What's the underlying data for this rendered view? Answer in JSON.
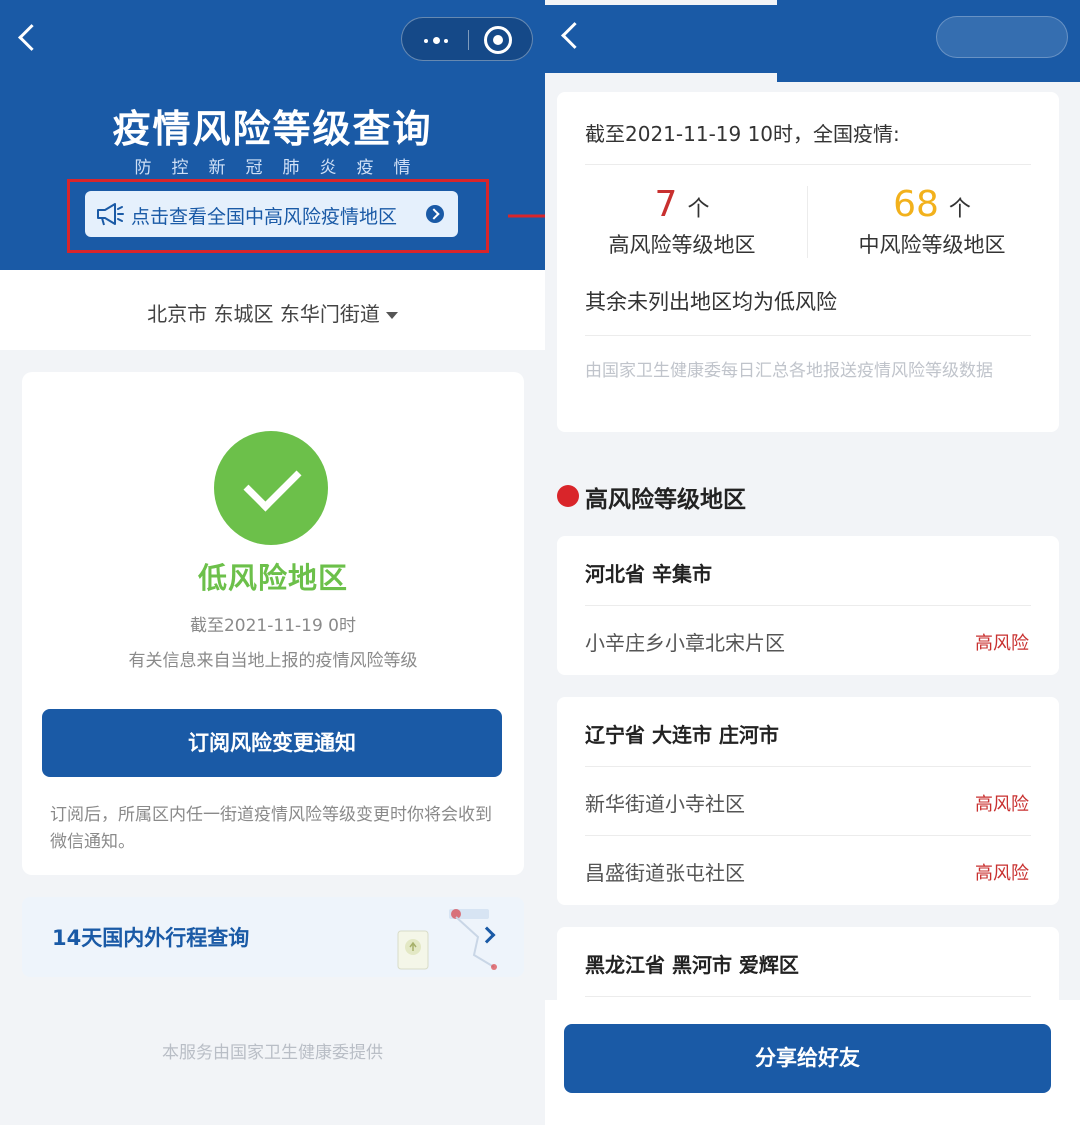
{
  "left": {
    "title": "疫情风险等级查询",
    "subtitle": "防控新冠肺炎疫情",
    "national_link": "点击查看全国中高风险疫情地区",
    "location": "北京市 东城区 东华门街道",
    "status": {
      "level": "低风险地区",
      "as_of": "截至2021-11-19 0时",
      "source": "有关信息来自当地上报的疫情风险等级"
    },
    "subscribe_button": "订阅风险变更通知",
    "subscribe_note": "订阅后，所属区内任一街道疫情风险等级变更时你将会收到微信通知。",
    "travel_query": "14天国内外行程查询",
    "footer": "本服务由国家卫生健康委提供"
  },
  "right": {
    "summary": {
      "title": "截至2021-11-19 10时，全国疫情:",
      "high_count": "7",
      "high_unit": "个",
      "high_label": "高风险等级地区",
      "mid_count": "68",
      "mid_unit": "个",
      "mid_label": "中风险等级地区",
      "low_note": "其余未列出地区均为低风险",
      "source_note": "由国家卫生健康委每日汇总各地报送疫情风险等级数据"
    },
    "section_high": "高风险等级地区",
    "regions": [
      {
        "title": "河北省 辛集市",
        "rows": [
          {
            "name": "小辛庄乡小章北宋片区",
            "level": "高风险"
          }
        ]
      },
      {
        "title": "辽宁省 大连市 庄河市",
        "rows": [
          {
            "name": "新华街道小寺社区",
            "level": "高风险"
          },
          {
            "name": "昌盛街道张屯社区",
            "level": "高风险"
          }
        ]
      },
      {
        "title": "黑龙江省 黑河市 爱辉区",
        "rows": []
      }
    ],
    "share_button": "分享给好友"
  },
  "colors": {
    "brand_blue": "#1a5aa6",
    "low_risk_green": "#6cc04a",
    "high_risk_red": "#c8302f",
    "mid_risk_yellow": "#f2b11c",
    "annotation_red": "#d9252a"
  },
  "icons": [
    "back-icon",
    "more-icon",
    "close-icon",
    "megaphone-icon",
    "arrow-circle-icon",
    "caret-down-icon",
    "check-circle-icon",
    "map-illustration-icon",
    "chevron-right-icon",
    "red-dot-icon"
  ]
}
